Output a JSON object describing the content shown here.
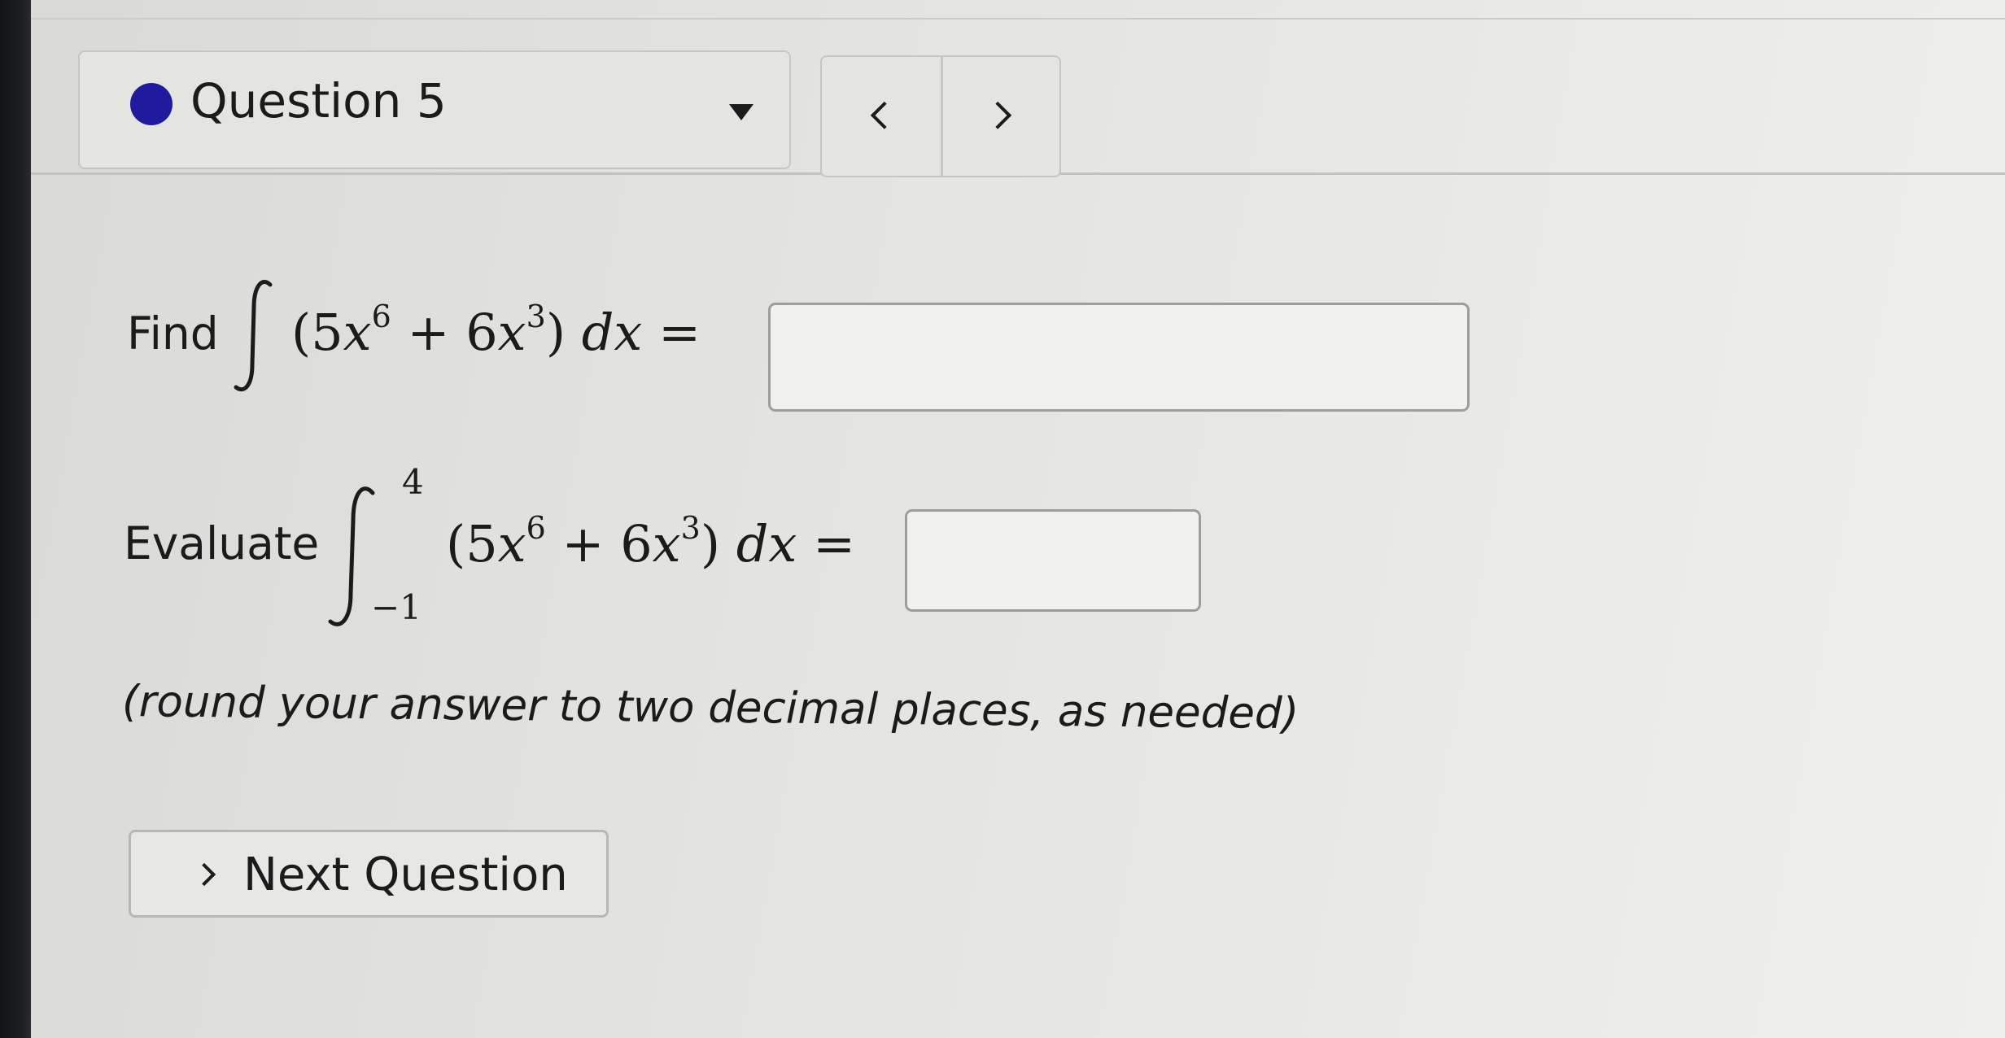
{
  "header": {
    "question_label": "Question 5",
    "status_color": "#1f1a9e",
    "dropdown_icon": "caret-down-icon",
    "prev_icon": "chevron-left-icon",
    "next_icon": "chevron-right-icon"
  },
  "problem": {
    "find_label": "Find",
    "evaluate_label": "Evaluate",
    "integrand": {
      "coef1": "5",
      "var": "x",
      "exp1": "6",
      "plus": "+",
      "coef2": "6",
      "exp2": "3",
      "differential": "dx",
      "equals": "="
    },
    "upper_limit": "4",
    "lower_limit": "−1",
    "indefinite_answer_value": "",
    "definite_answer_value": "",
    "note": "(round your answer to two decimal places, as needed)"
  },
  "footer": {
    "next_question_label": "Next Question"
  }
}
